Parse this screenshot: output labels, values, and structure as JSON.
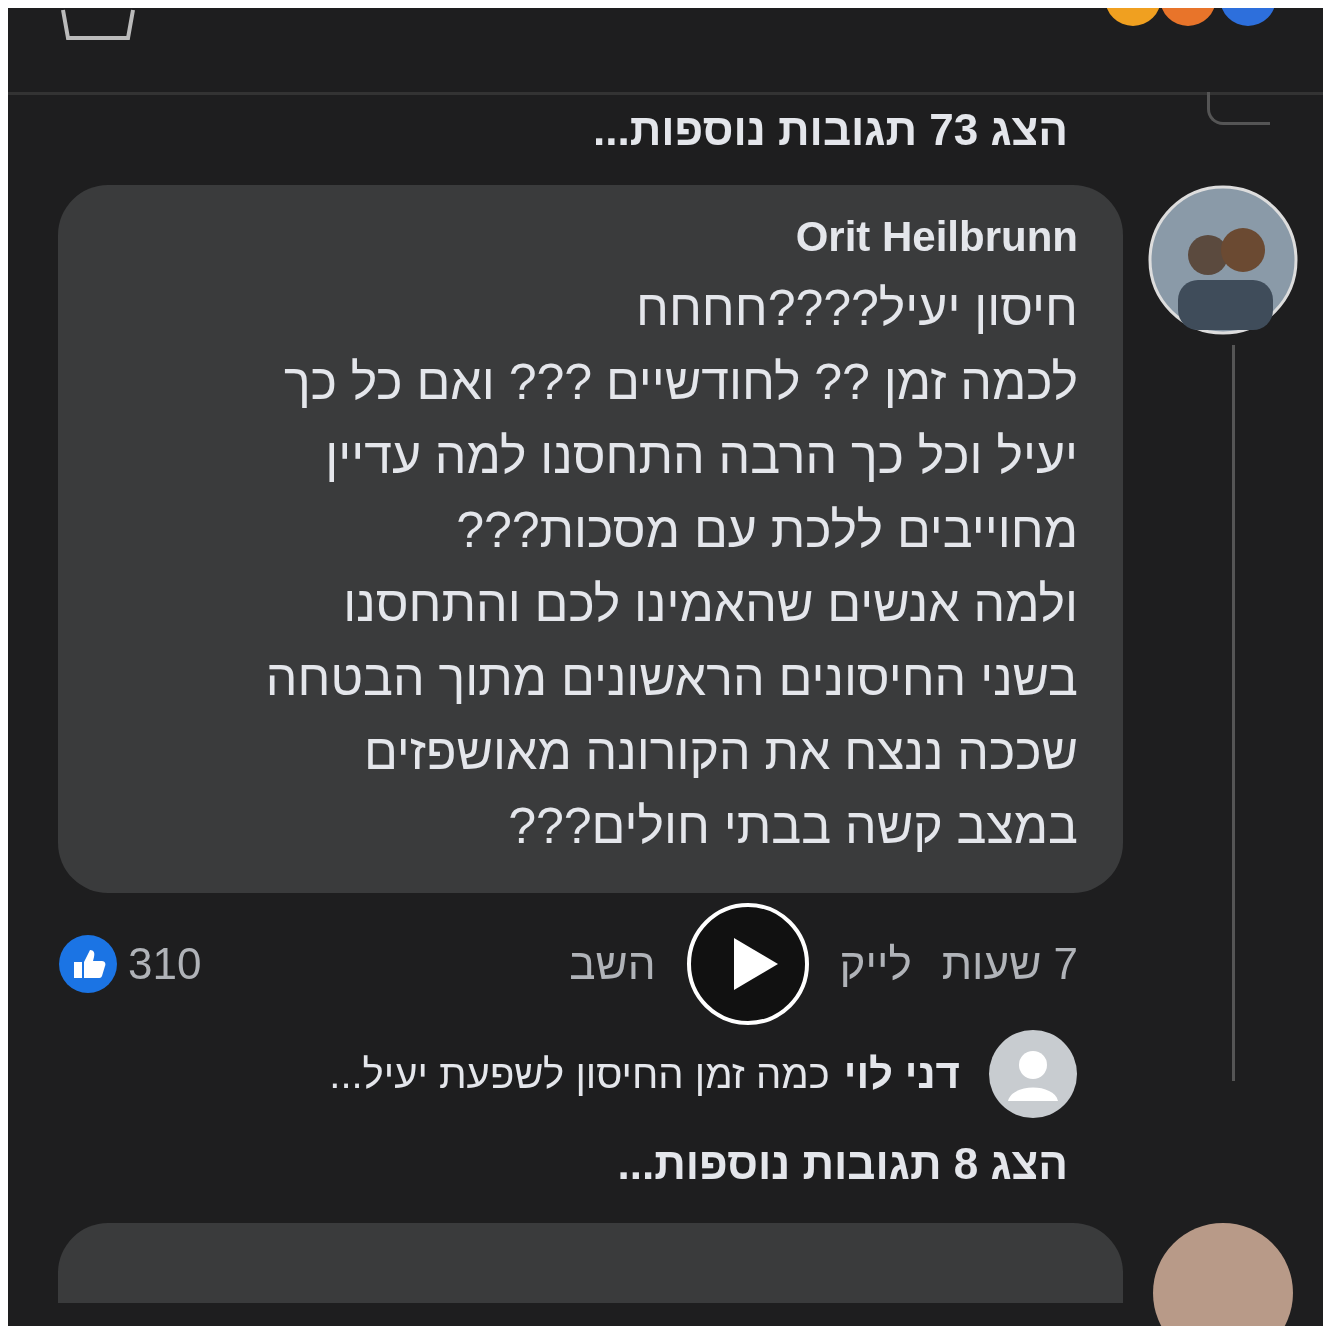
{
  "top_more_replies": {
    "label": "הצג 73 תגובות נוספות..."
  },
  "comment": {
    "author": "Orit Heilbrunn",
    "text": "חיסון יעיל????חחחח\nלכמה זמן ?? לחודשיים ??? ואם כל כך\nיעיל וכל כך הרבה התחסנו למה עדיין\nמחוייבים ללכת עם מסכות???\nולמה אנשים שהאמינו לכם והתחסנו\nבשני החיסונים הראשונים מתוך הבטחה\nשככה ננצח את הקורונה מאושפזים\nבמצב קשה בבתי חולים???",
    "time": "7 שעות",
    "actions": [
      "לייק",
      "השב"
    ],
    "like_count": "310"
  },
  "reply_preview": {
    "author": "דני לוי",
    "text": "כמה זמן החיסון לשפעת יעיל..."
  },
  "bottom_more_replies": {
    "label": "הצג 8 תגובות נוספות..."
  }
}
